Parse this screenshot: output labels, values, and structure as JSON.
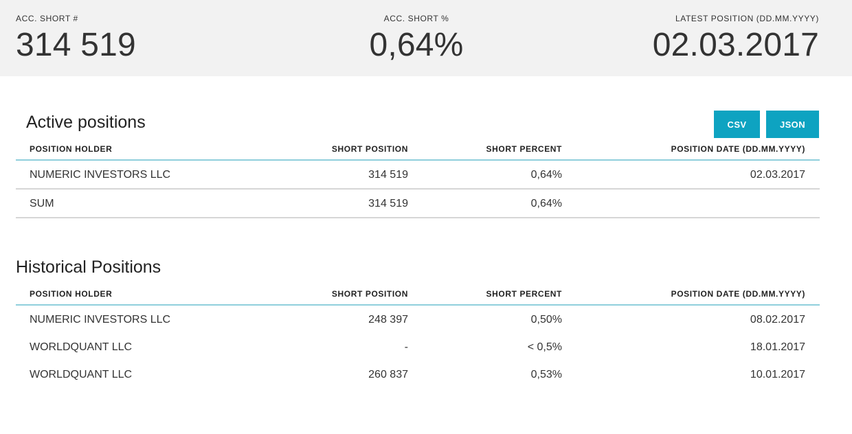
{
  "summary": {
    "acc_short_label": "ACC. SHORT #",
    "acc_short_value": "314 519",
    "acc_short_pct_label": "ACC. SHORT %",
    "acc_short_pct_value": "0,64%",
    "latest_position_label": "LATEST POSITION (DD.MM.YYYY)",
    "latest_position_value": "02.03.2017"
  },
  "active": {
    "title": "Active positions",
    "buttons": {
      "csv": "CSV",
      "json": "JSON"
    },
    "columns": [
      "POSITION HOLDER",
      "SHORT POSITION",
      "SHORT PERCENT",
      "POSITION DATE (DD.MM.YYYY)"
    ],
    "rows": [
      {
        "holder": "NUMERIC INVESTORS LLC",
        "position": "314 519",
        "percent": "0,64%",
        "date": "02.03.2017"
      },
      {
        "holder": "SUM",
        "position": "314 519",
        "percent": "0,64%",
        "date": ""
      }
    ]
  },
  "historical": {
    "title": "Historical Positions",
    "columns": [
      "POSITION HOLDER",
      "SHORT POSITION",
      "SHORT PERCENT",
      "POSITION DATE (DD.MM.YYYY)"
    ],
    "rows": [
      {
        "holder": "NUMERIC INVESTORS LLC",
        "position": "248 397",
        "percent": "0,50%",
        "date": "08.02.2017"
      },
      {
        "holder": "WORLDQUANT LLC",
        "position": "-",
        "percent": "< 0,5%",
        "date": "18.01.2017"
      },
      {
        "holder": "WORLDQUANT LLC",
        "position": "260 837",
        "percent": "0,53%",
        "date": "10.01.2017"
      }
    ]
  },
  "colors": {
    "accent": "#0ea3c1",
    "header_bg": "#f2f2f2",
    "header_divider": "#8fcfdc",
    "row_divider": "#d6d6d6"
  }
}
